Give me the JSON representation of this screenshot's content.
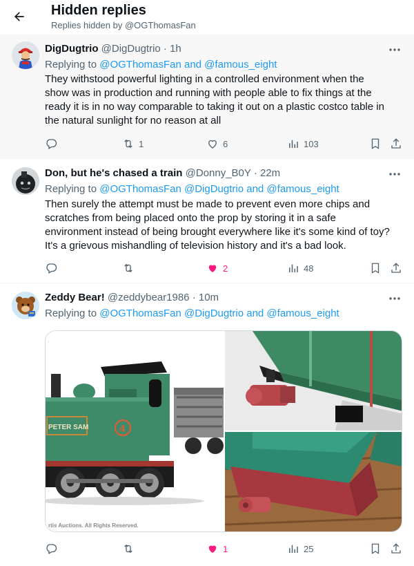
{
  "header": {
    "title": "Hidden replies",
    "subtitle": "Replies hidden by @OGThomasFan"
  },
  "tweets": [
    {
      "name": "DigDugtrio",
      "handle": "@DigDugtrio",
      "time": "· 1h",
      "replying_prefix": "Replying to ",
      "mentions": "@OGThomasFan and @famous_eight",
      "lines": [
        "They withstood powerful lighting in a controlled environment when the",
        "show was in production and running with people able to fix things at the",
        "ready it is in no way comparable to taking it out on a plastic costco table in",
        "the natural sunlight for no reason at all"
      ],
      "retweets": "1",
      "likes": "6",
      "views": "103"
    },
    {
      "name": "Don, but he's chased a train",
      "handle": "@Donny_B0Y",
      "time": "· 22m",
      "replying_prefix": "Replying to ",
      "mentions": "@OGThomasFan @DigDugtrio and @famous_eight",
      "lines": [
        "Then surely the attempt must be made to prevent even more chips and",
        "scratches from being placed onto the prop by storing it in a safe",
        "environment instead of being brought everywhere like it's some kind of toy?",
        "It's a grievous mishandling of television history and it's a bad look."
      ],
      "retweets": "",
      "likes": "2",
      "views": "48"
    },
    {
      "name": "Zeddy Bear!",
      "handle": "@zeddybear1986",
      "time": "· 10m",
      "replying_prefix": "Replying to ",
      "mentions": "@OGThomasFan @DigDugtrio and @famous_eight",
      "lines": [],
      "retweets": "",
      "likes": "1",
      "views": "25",
      "media": {
        "plate_text": "PETER SAM",
        "number": "4",
        "caption": "rtis Auctions. All Rights Reserved."
      }
    }
  ],
  "colors": {
    "accent": "#1d9bf0",
    "like": "#f91880",
    "muted": "#536471",
    "engine_green": "#3f8a68",
    "buffer_red": "#b8454a"
  }
}
